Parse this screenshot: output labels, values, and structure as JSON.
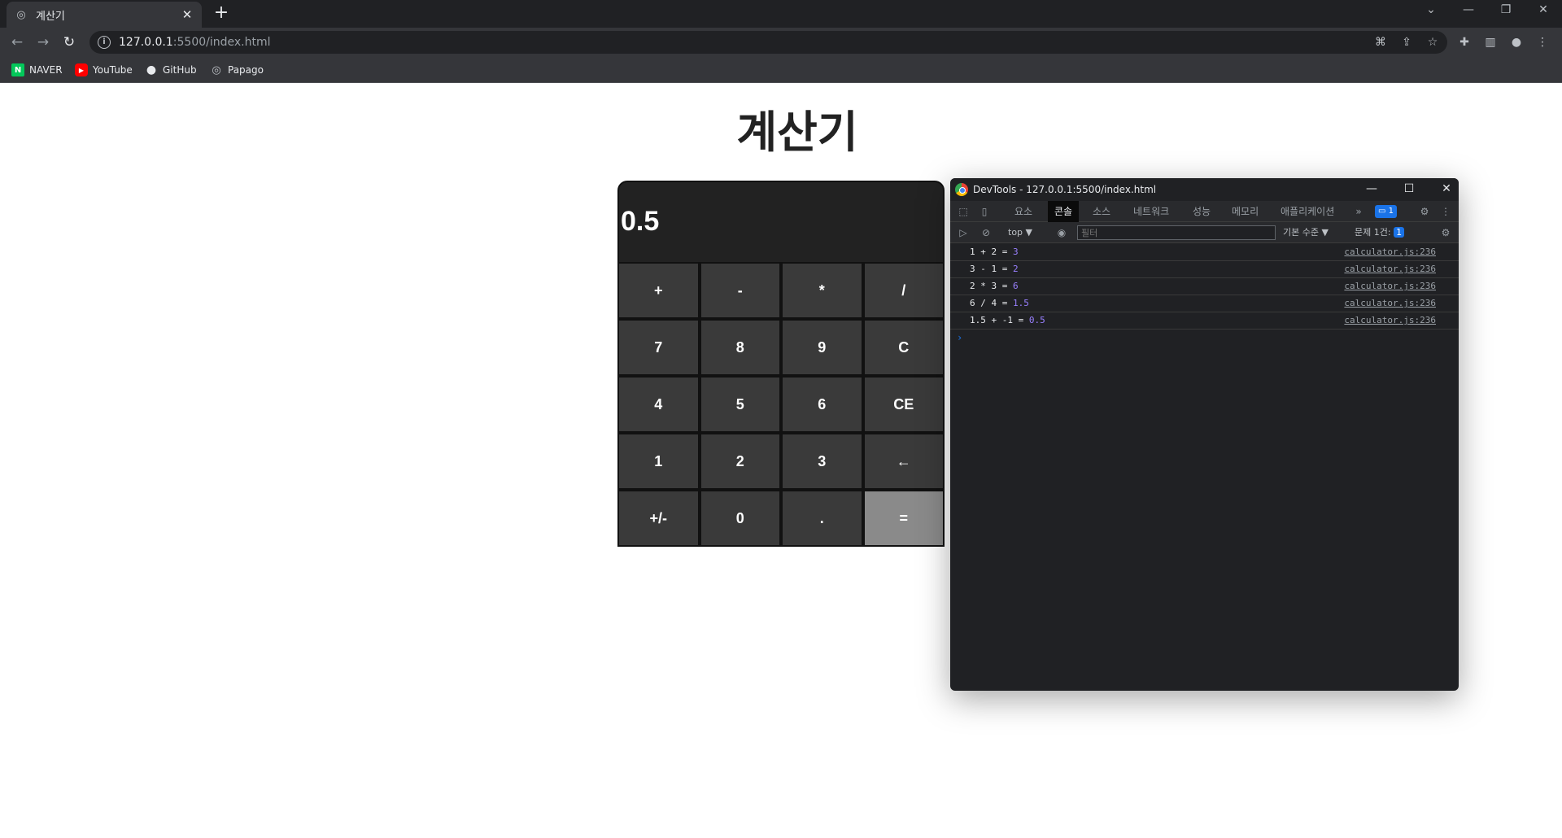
{
  "browser": {
    "tab_title": "계산기",
    "tab_close": "✕",
    "new_tab": "+",
    "url_host": "127.0.0.1",
    "url_rest": ":5500/index.html"
  },
  "bookmarks": [
    {
      "label": "NAVER",
      "icon": "N"
    },
    {
      "label": "YouTube",
      "icon": "▶"
    },
    {
      "label": "GitHub",
      "icon": "●"
    },
    {
      "label": "Papago",
      "icon": "◎"
    }
  ],
  "page": {
    "title": "계산기",
    "display": "0.5"
  },
  "keys": [
    "+",
    "-",
    "*",
    "/",
    "7",
    "8",
    "9",
    "C",
    "4",
    "5",
    "6",
    "CE",
    "1",
    "2",
    "3",
    "←",
    "+/-",
    "0",
    ".",
    "="
  ],
  "devtools": {
    "title": "DevTools - 127.0.0.1:5500/index.html",
    "tabs": [
      "요소",
      "콘솔",
      "소스",
      "네트워크",
      "성능",
      "메모리",
      "애플리케이션"
    ],
    "active_tab": "콘솔",
    "more": "»",
    "badge": "1",
    "context": "top ▼",
    "filter_placeholder": "필터",
    "levels": "기본 수준 ▼",
    "issues_label": "문제 1건:",
    "issues_count": "1",
    "console_lines": [
      {
        "expr": "1 + 2 = ",
        "result": "3",
        "source": "calculator.js:236"
      },
      {
        "expr": "3 - 1 = ",
        "result": "2",
        "source": "calculator.js:236"
      },
      {
        "expr": "2 * 3 = ",
        "result": "6",
        "source": "calculator.js:236"
      },
      {
        "expr": "6 / 4 = ",
        "result": "1.5",
        "source": "calculator.js:236"
      },
      {
        "expr": "1.5 + -1 = ",
        "result": "0.5",
        "source": "calculator.js:236"
      }
    ],
    "prompt": "›"
  }
}
